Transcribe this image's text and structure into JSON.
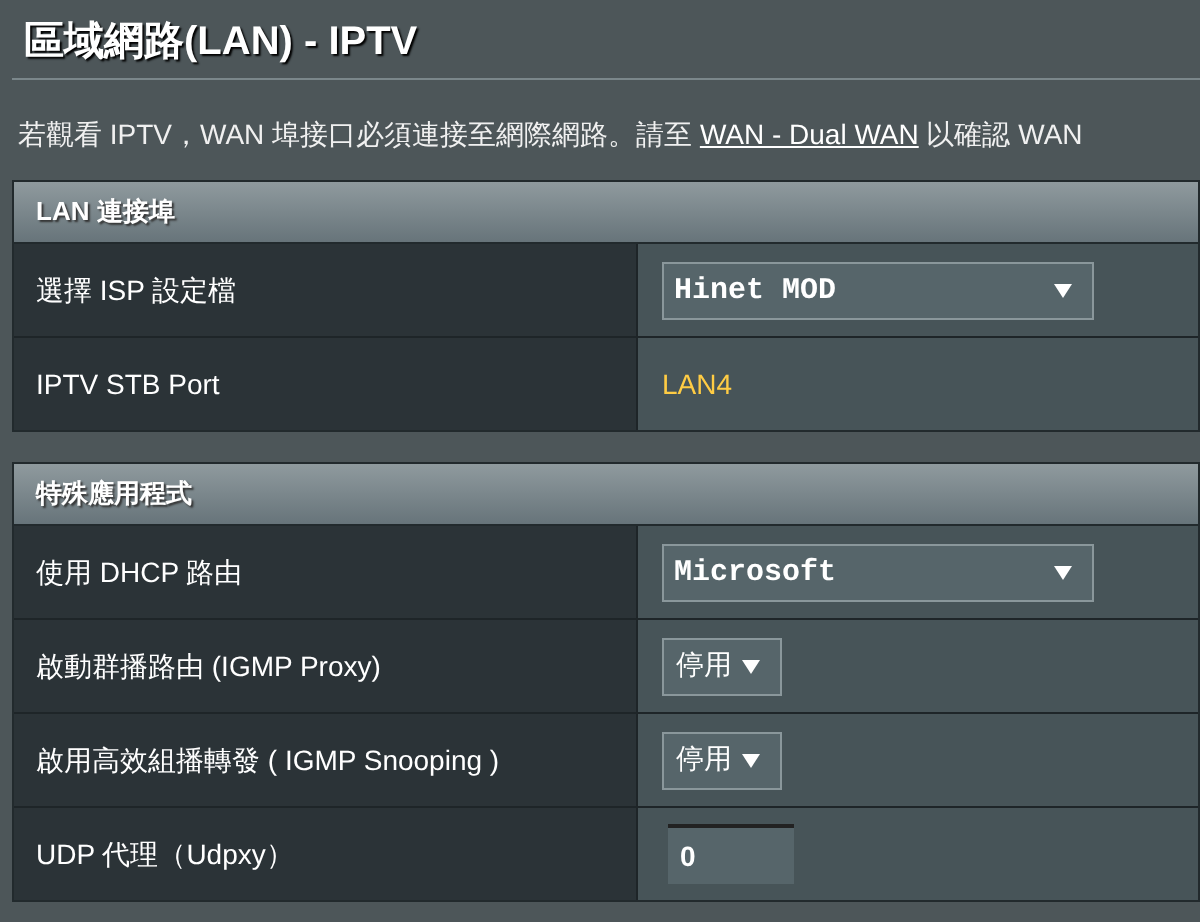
{
  "page_title": "區域網路(LAN) - IPTV",
  "note": {
    "before": "若觀看 IPTV，WAN 埠接口必須連接至網際網路。請至 ",
    "link": "WAN - Dual WAN",
    "after": " 以確認 WAN"
  },
  "sections": [
    {
      "title": "LAN 連接埠",
      "rows": [
        {
          "label": "選擇 ISP 設定檔",
          "kind": "select",
          "value": "Hinet MOD"
        },
        {
          "label": "IPTV STB Port",
          "kind": "text",
          "value": "LAN4"
        }
      ]
    },
    {
      "title": "特殊應用程式",
      "rows": [
        {
          "label": "使用 DHCP 路由",
          "kind": "select",
          "value": "Microsoft"
        },
        {
          "label": "啟動群播路由 (IGMP Proxy)",
          "kind": "small_select",
          "value": "停用"
        },
        {
          "label": "啟用高效組播轉發 ( IGMP Snooping )",
          "kind": "small_select",
          "value": "停用"
        },
        {
          "label": "UDP 代理（Udpxy）",
          "kind": "input",
          "value": "0"
        }
      ]
    }
  ]
}
